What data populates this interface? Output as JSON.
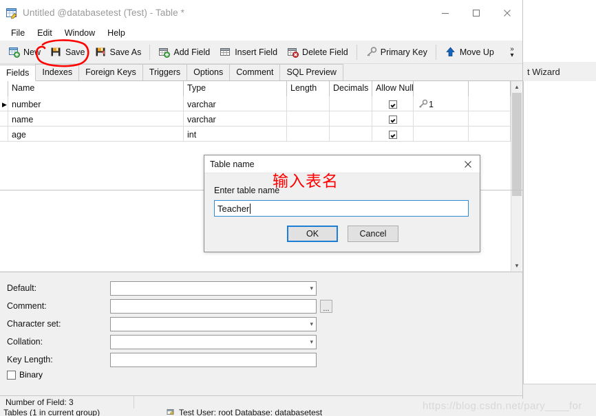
{
  "window": {
    "title": "Untitled @databasetest (Test) - Table *",
    "icon": "table-edit-icon",
    "controls": {
      "minimize": "minimize-icon",
      "maximize": "maximize-icon",
      "close": "close-icon"
    }
  },
  "menubar": {
    "items": [
      "File",
      "Edit",
      "Window",
      "Help"
    ]
  },
  "toolbar": {
    "buttons": [
      {
        "label": "New",
        "icon": "new-table-icon"
      },
      {
        "label": "Save",
        "icon": "save-disk-icon"
      },
      {
        "label": "Save As",
        "icon": "save-as-disk-icon"
      },
      {
        "label": "Add Field",
        "icon": "add-field-icon"
      },
      {
        "label": "Insert Field",
        "icon": "insert-field-icon"
      },
      {
        "label": "Delete Field",
        "icon": "delete-field-icon"
      },
      {
        "label": "Primary Key",
        "icon": "key-icon"
      },
      {
        "label": "Move Up",
        "icon": "arrow-up-icon"
      }
    ],
    "overflow": "»"
  },
  "tabs": {
    "items": [
      "Fields",
      "Indexes",
      "Foreign Keys",
      "Triggers",
      "Options",
      "Comment",
      "SQL Preview"
    ],
    "active": "Fields"
  },
  "grid": {
    "columns": [
      "Name",
      "Type",
      "Length",
      "Decimals",
      "Allow Null",
      ""
    ],
    "rows": [
      {
        "selected": true,
        "name": "number",
        "type": "varchar",
        "length": "",
        "decimals": "",
        "allow_null": true,
        "key": "1",
        "key_icon": "primary-key-icon"
      },
      {
        "selected": false,
        "name": "name",
        "type": "varchar",
        "length": "",
        "decimals": "",
        "allow_null": true,
        "key": "",
        "key_icon": ""
      },
      {
        "selected": false,
        "name": "age",
        "type": "int",
        "length": "",
        "decimals": "",
        "allow_null": true,
        "key": "",
        "key_icon": ""
      }
    ]
  },
  "properties": {
    "fields": [
      {
        "label": "Default:",
        "value": "",
        "control": "combo"
      },
      {
        "label": "Comment:",
        "value": "",
        "control": "text-with-button",
        "button": "..."
      },
      {
        "label": "Character set:",
        "value": "",
        "control": "combo"
      },
      {
        "label": "Collation:",
        "value": "",
        "control": "combo"
      },
      {
        "label": "Key Length:",
        "value": "",
        "control": "text"
      }
    ],
    "binary": {
      "label": "Binary",
      "checked": false
    }
  },
  "dialog": {
    "title": "Table name",
    "close": "close-icon",
    "prompt": "Enter table name",
    "input_value": "Teacher",
    "buttons": {
      "ok": "OK",
      "cancel": "Cancel"
    }
  },
  "annotations": {
    "chinese_note": "输入表名",
    "circle_target": "save-button",
    "color": "#ff0000"
  },
  "statusbar": {
    "field_count": "Number of Field: 3",
    "tables_info": "Tables (1 in current group)",
    "connection": "Test   User: root   Database: databasetest",
    "connection_icon": "database-connection-icon"
  },
  "background_window": {
    "partial_label": "t Wizard"
  },
  "watermark": "https://blog.csdn.net/pary____for"
}
